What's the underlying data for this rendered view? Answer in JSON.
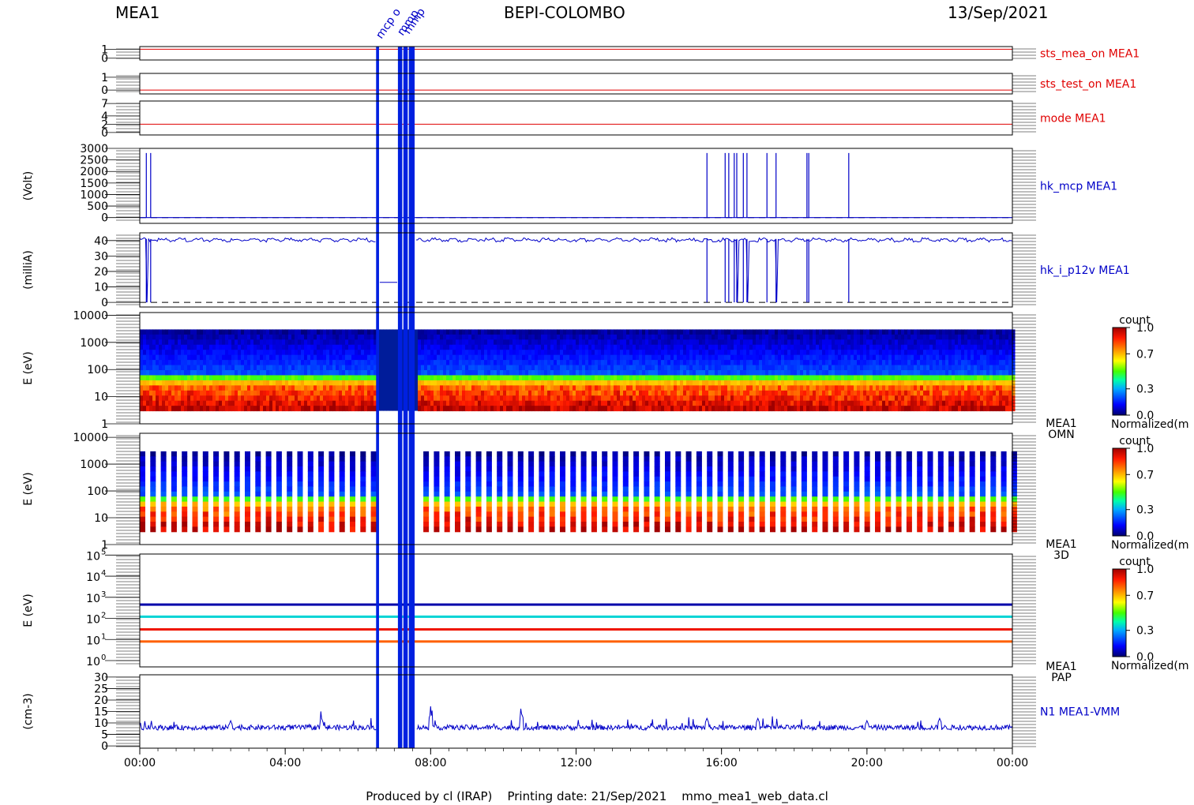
{
  "header": {
    "left": "MEA1",
    "center": "BEPI-COLOMBO",
    "right": "13/Sep/2021"
  },
  "footer": {
    "text": "Produced by cl (IRAP)    Printing date: 21/Sep/2021    mmo_mea1_web_data.cl"
  },
  "colors": {
    "red_line": "#e00000",
    "blue_line": "#0000c8",
    "band_blue": "#0020e0",
    "frame": "#000000"
  },
  "chart_data": {
    "type": "line",
    "x_axis": {
      "ticks": [
        "00:00",
        "04:00",
        "08:00",
        "12:00",
        "16:00",
        "20:00",
        "00:00"
      ],
      "range_hours": [
        0,
        24
      ]
    },
    "event_labels": [
      "mcp o",
      "mmp",
      "mmp"
    ],
    "gap_bands_hours": [
      [
        6.5,
        6.58
      ],
      [
        7.1,
        7.22
      ],
      [
        7.25,
        7.37
      ],
      [
        7.4,
        7.56
      ]
    ],
    "panels": [
      {
        "id": "sts_mea_on",
        "label": "sts_mea_on MEA1",
        "label_color": "#e00000",
        "kind": "line",
        "ylim": [
          -0.2,
          1.3
        ],
        "yticks": [
          "1",
          "0"
        ],
        "ytick_values": [
          1,
          0
        ],
        "series": {
          "constant": 1
        }
      },
      {
        "id": "sts_test_on",
        "label": "sts_test_on MEA1",
        "label_color": "#e00000",
        "kind": "line",
        "ylim": [
          -0.3,
          1.3
        ],
        "yticks": [
          "1",
          "0"
        ],
        "ytick_values": [
          1,
          0
        ],
        "series": {
          "constant": 0
        }
      },
      {
        "id": "mode",
        "label": "mode MEA1",
        "label_color": "#e00000",
        "kind": "line",
        "ylim": [
          -0.6,
          7.6
        ],
        "yticks": [
          "7",
          "4",
          "2",
          "0"
        ],
        "ytick_values": [
          7,
          4,
          2,
          0
        ],
        "series": {
          "constant": 2
        }
      },
      {
        "id": "hk_mcp",
        "label": "hk_mcp MEA1",
        "label_color": "#0000c8",
        "ylabel": "(Volt)",
        "kind": "line",
        "ylim": [
          -250,
          3000
        ],
        "yticks": [
          "3000",
          "2500",
          "2000",
          "1500",
          "1000",
          "500",
          "0"
        ],
        "ytick_values": [
          3000,
          2500,
          2000,
          1500,
          1000,
          500,
          0
        ],
        "baseline_dashed": 0,
        "high_value": 2800,
        "low_value": 0,
        "high_intervals_hours": [
          [
            0.18,
            0.3
          ],
          [
            15.6,
            16.1
          ],
          [
            16.2,
            16.35
          ],
          [
            16.42,
            16.6
          ],
          [
            16.7,
            17.25
          ],
          [
            17.5,
            18.35
          ],
          [
            18.4,
            19.5
          ]
        ]
      },
      {
        "id": "hk_i_p12v",
        "label": "hk_i_p12v MEA1",
        "label_color": "#0000c8",
        "ylabel": "(milliA)",
        "kind": "line",
        "ylim": [
          -3,
          45
        ],
        "yticks": [
          "40",
          "30",
          "20",
          "10",
          "0"
        ],
        "ytick_values": [
          40,
          30,
          20,
          10,
          0
        ],
        "baseline_dashed": 0,
        "nominal_value": 41,
        "dropout_intervals_hours": [
          [
            0.18,
            0.3
          ],
          [
            15.6,
            16.1
          ],
          [
            16.2,
            16.35
          ],
          [
            16.42,
            16.6
          ],
          [
            16.7,
            17.25
          ],
          [
            17.5,
            18.35
          ],
          [
            18.4,
            19.5
          ]
        ],
        "plateau_value": 13,
        "plateau_interval_hours": [
          6.58,
          7.1
        ]
      },
      {
        "id": "omn",
        "label_lines": [
          "MEA1",
          "OMN"
        ],
        "ylabel": "E (eV)",
        "kind": "spectrogram",
        "log_range": [
          0,
          4.1
        ],
        "yticks": [
          "10000",
          "1000",
          "100",
          "10",
          "1"
        ],
        "ytick_values": [
          10000,
          1000,
          100,
          10,
          1
        ],
        "energy_range_eV": [
          3,
          3000
        ],
        "colorbar": {
          "title": "count",
          "ticks": [
            "1.0",
            "0.7",
            "0.3",
            "0.0"
          ],
          "bottom_label": "Normalized(m"
        }
      },
      {
        "id": "3d",
        "label_lines": [
          "MEA1",
          "3D"
        ],
        "ylabel": "E (eV)",
        "kind": "spectrogram_striped",
        "log_range": [
          0,
          4.15
        ],
        "yticks": [
          "10000",
          "1000",
          "100",
          "10",
          "1"
        ],
        "ytick_values": [
          10000,
          1000,
          100,
          10,
          1
        ],
        "energy_range_eV": [
          3,
          3000
        ],
        "colorbar": {
          "title": "count",
          "ticks": [
            "1.0",
            "0.7",
            "0.3",
            "0.0"
          ],
          "bottom_label": "Normalized(m"
        }
      },
      {
        "id": "pap",
        "label_lines": [
          "MEA1",
          "PAP"
        ],
        "ylabel": "E (eV)",
        "kind": "spectrogram_lines",
        "log_range": [
          -0.3,
          5.05
        ],
        "yticks_exp": [
          "5",
          "4",
          "3",
          "2",
          "1",
          "0"
        ],
        "ytick_values_log": [
          5,
          4,
          3,
          2,
          1,
          0
        ],
        "ytick_base": "10",
        "line_energies_eV": [
          450,
          120,
          30,
          8
        ],
        "colorbar": {
          "title": "count",
          "ticks": [
            "1.0",
            "0.7",
            "0.3",
            "0.0"
          ],
          "bottom_label": "Normalized(m"
        }
      },
      {
        "id": "n1",
        "label": "N1 MEA1-VMM",
        "label_color": "#0000c8",
        "ylabel": "(cm-3)",
        "kind": "line",
        "ylim": [
          -1,
          31
        ],
        "yticks": [
          "30",
          "25",
          "20",
          "15",
          "10",
          "5",
          "0"
        ],
        "ytick_values": [
          30,
          25,
          20,
          15,
          10,
          5,
          0
        ],
        "typical_value": 8,
        "peak_values": [
          [
            2.5,
            11
          ],
          [
            5.0,
            12
          ],
          [
            8.0,
            14
          ],
          [
            10.5,
            14
          ],
          [
            15.6,
            12
          ],
          [
            17.0,
            12
          ],
          [
            20.0,
            11
          ],
          [
            22.0,
            12
          ]
        ]
      }
    ]
  }
}
